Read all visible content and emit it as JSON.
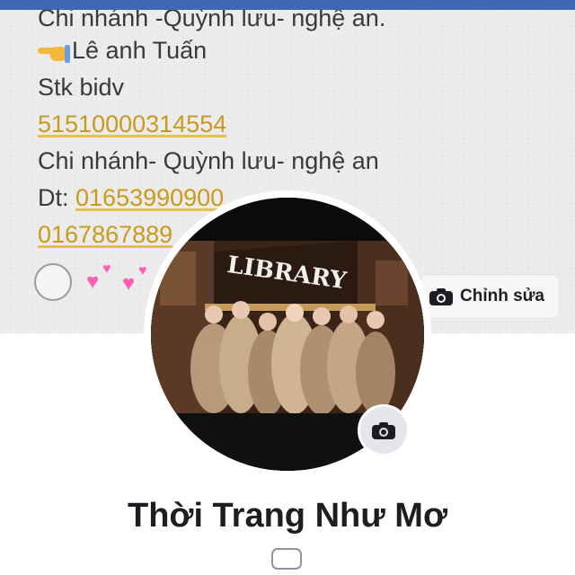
{
  "cover": {
    "lines": {
      "branch_top": "Chi nhánh -Quỳnh lưu- nghệ an.",
      "name": "Lê anh Tuấn",
      "bank": "Stk bidv",
      "account": "51510000314554",
      "branch": "Chi nhánh- Quỳnh lưu- nghệ an",
      "phone_label": "Dt: ",
      "phone1": "01653990900",
      "phone2": "0167867889"
    },
    "emoji": {
      "pointing_hand": "backhand-index-pointing-right-icon",
      "hearts": "two-hearts-icon"
    },
    "edit_button_label": "Chỉnh sửa"
  },
  "avatar": {
    "sign_text": "LIBRARY"
  },
  "profile": {
    "name": "Thời Trang Như Mơ"
  },
  "colors": {
    "top_bar": "#4267b2",
    "link_number": "#c99a1c",
    "text_dark": "#1c1e21"
  }
}
